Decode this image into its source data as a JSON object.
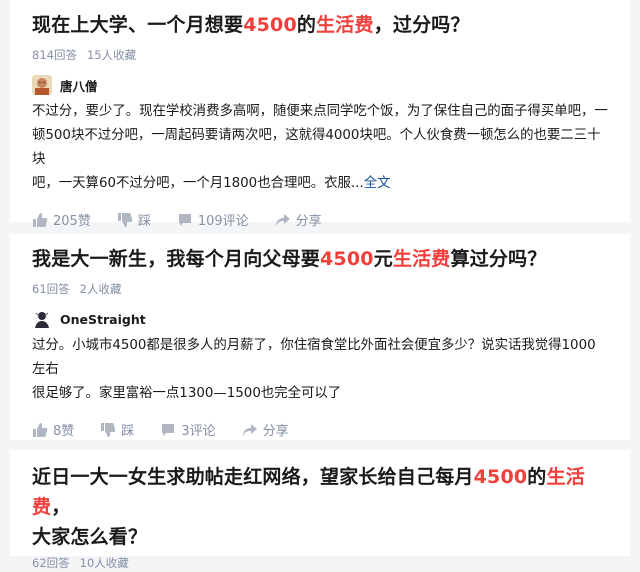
{
  "cards": [
    {
      "title_parts": [
        "现在上大学、一个月想要",
        "4500",
        "的",
        "生活费",
        "，过分吗？"
      ],
      "meta": {
        "answers": "814回答",
        "favorites": "15人收藏"
      },
      "author": {
        "name": "唐八僧",
        "avatar_icon": "monk-avatar-icon"
      },
      "excerpt_lines": [
        "不过分，要少了。现在学校消费多高啊，随便来点同学吃个饭，为了保住自己的面子得买单吧，一",
        "顿500块不过分吧，一周起码要请两次吧，这就得4000块吧。个人伙食费一顿怎么的也要二三十块",
        "吧，一天算60不过分吧，一个月1800也合理吧。衣服..."
      ],
      "more_link": "全文",
      "actions": {
        "likes": "205赞",
        "dislike": "踩",
        "comments": "109评论",
        "share": "分享"
      }
    },
    {
      "title_parts": [
        "我是大一新生，我每个月向父母要",
        "4500",
        "元",
        "生活费",
        "算过分吗？"
      ],
      "meta": {
        "answers": "61回答",
        "favorites": "2人收藏"
      },
      "author": {
        "name": "OneStraight",
        "avatar_icon": "dark-avatar-icon"
      },
      "excerpt_lines": [
        "过分。小城市4500都是很多人的月薪了，你住宿食堂比外面社会便宜多少？说实话我觉得1000左右",
        "很足够了。家里富裕一点1300—1500也完全可以了"
      ],
      "actions": {
        "likes": "8赞",
        "dislike": "踩",
        "comments": "3评论",
        "share": "分享"
      }
    },
    {
      "title_line1_parts": [
        "近日一大一女生求助帖走红网络，望家长给自己每月",
        "4500",
        "的",
        "生活费",
        "，"
      ],
      "title_line2": "大家怎么看？",
      "meta": {
        "answers": "62回答",
        "favorites": "10人收藏"
      }
    }
  ],
  "colors": {
    "highlight": "#f1403c",
    "meta": "#8590a6",
    "link": "#175199",
    "background": "#f4f5f7"
  }
}
